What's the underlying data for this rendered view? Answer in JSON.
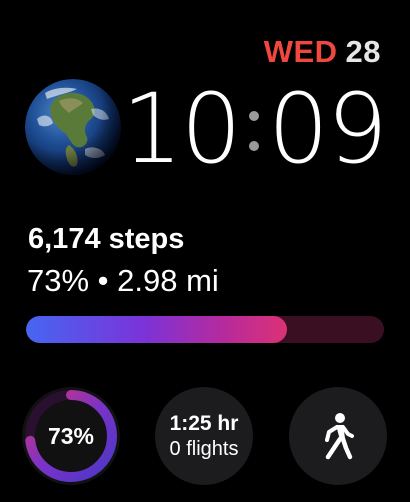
{
  "date": {
    "weekday": "WED",
    "day": "28",
    "weekday_color": "#f0473f"
  },
  "time": {
    "hours": "10",
    "minutes": "09"
  },
  "globe": {
    "icon": "earth-globe-icon"
  },
  "activity": {
    "steps_label": "6,174 steps",
    "distance_line": "73% • 2.98 mi",
    "progress_fraction": 0.73,
    "bar_colors": [
      "#4666f2",
      "#7b33d8",
      "#b52a9e",
      "#dc3175"
    ],
    "track_color": "#3a0f22"
  },
  "complications": {
    "ring": {
      "label": "73%",
      "value_fraction": 0.73,
      "colors": [
        "#4a37c6",
        "#7a33c8",
        "#d23477"
      ]
    },
    "text": {
      "line1": "1:25 hr",
      "line2": "0 flights"
    },
    "walk": {
      "icon": "walking-person-icon"
    }
  }
}
